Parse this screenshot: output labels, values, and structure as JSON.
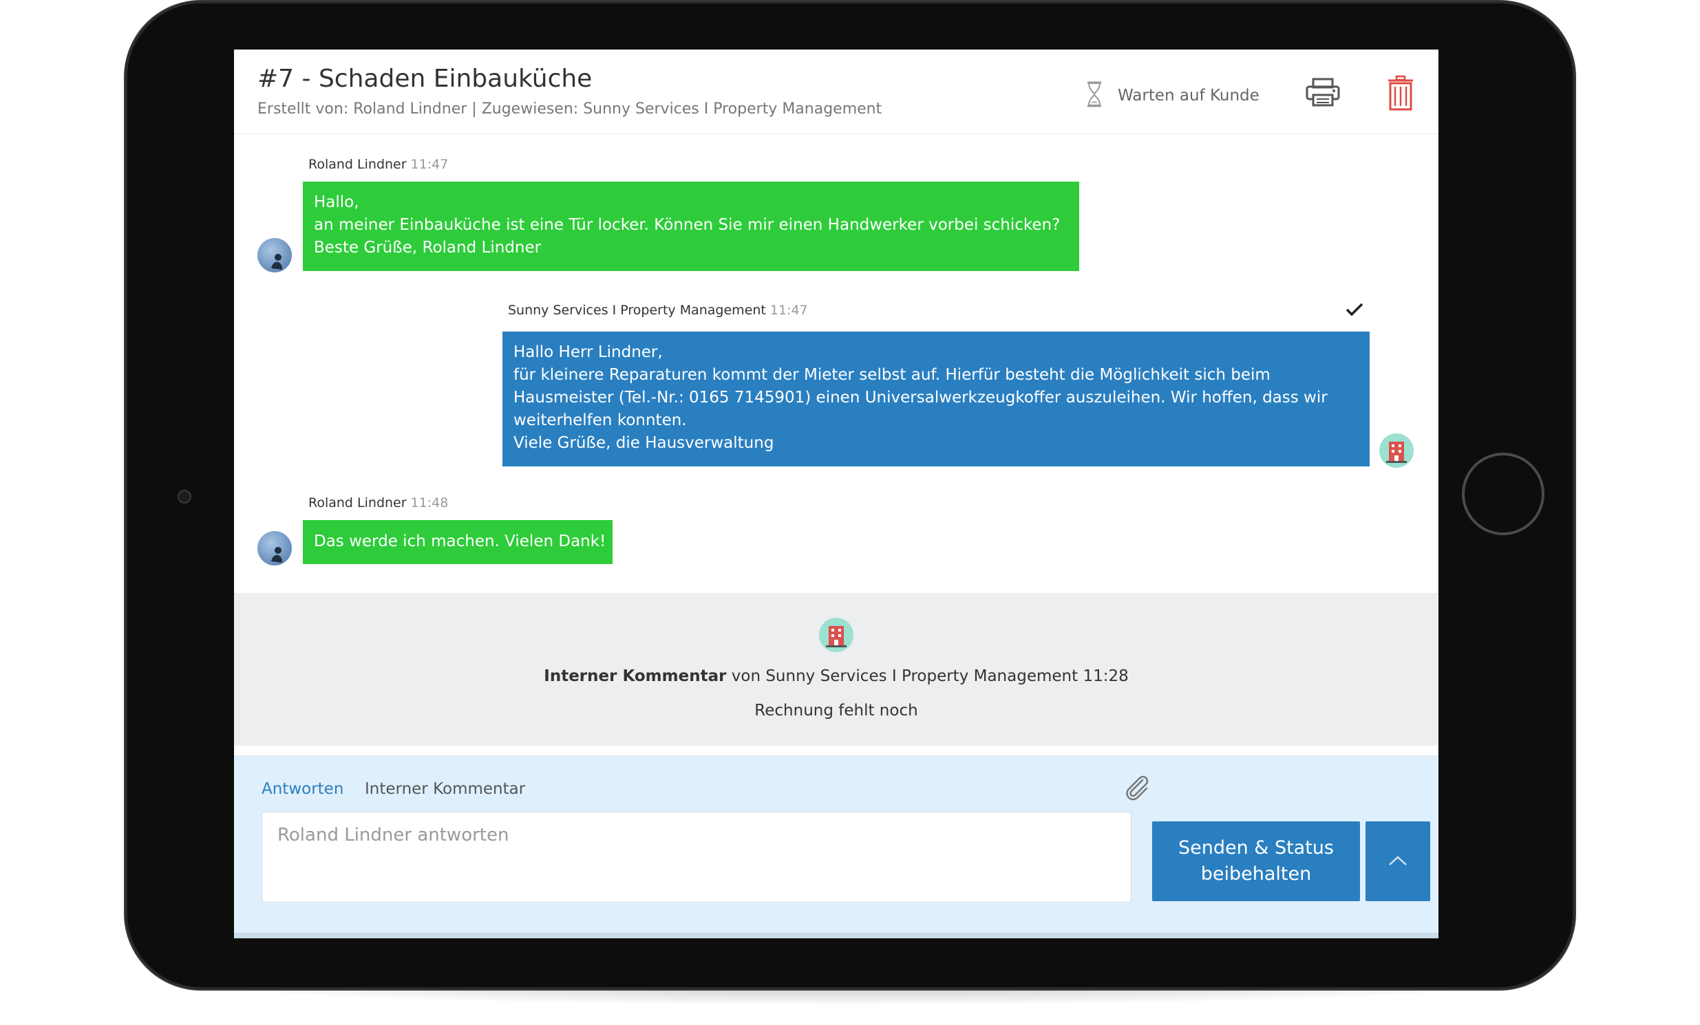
{
  "ticket": {
    "title": "#7 - Schaden Einbauküche",
    "subtitle": "Erstellt von: Roland Lindner | Zugewiesen: Sunny Services I Property Management",
    "status_label": "Warten auf Kunde",
    "status_icon": "hourglass-icon"
  },
  "toolbar": {
    "print_icon": "printer-icon",
    "delete_icon": "trash-icon",
    "delete_color": "#e04b43"
  },
  "messages": [
    {
      "sender": "Roland Lindner",
      "time": "11:47",
      "lines": [
        "Hallo,",
        "an meiner Einbauküche ist eine Tür locker. Können Sie mir einen Handwerker vorbei schicken?",
        "Beste Grüße, Roland Lindner"
      ]
    },
    {
      "sender": "Sunny Services I Property Management",
      "time": "11:47",
      "lines": [
        "Hallo Herr Lindner,",
        "für kleinere Reparaturen kommt der Mieter selbst auf. Hierfür besteht die Möglichkeit sich beim",
        "Hausmeister (Tel.-Nr.: 0165 7145901) einen Universalwerkzeugkoffer auszuleihen. Wir hoffen, dass wir",
        "weiterhelfen konnten.",
        "Viele Grüße, die Hausverwaltung"
      ]
    },
    {
      "sender": "Roland Lindner",
      "time": "11:48",
      "lines": [
        "Das werde ich machen. Vielen Dank!"
      ]
    }
  ],
  "internal_comment": {
    "label": "Interner Kommentar",
    "by": "von Sunny Services I Property Management 11:28",
    "text": "Rechnung fehlt noch"
  },
  "reply": {
    "tab_reply": "Antworten",
    "tab_internal": "Interner Kommentar",
    "placeholder": "Roland Lindner antworten",
    "send_line1": "Senden & Status",
    "send_line2": "beibehalten"
  },
  "colors": {
    "customer_bubble": "#2ecc3a",
    "agency_bubble": "#2a7fc0",
    "accent": "#2a7fc0"
  }
}
